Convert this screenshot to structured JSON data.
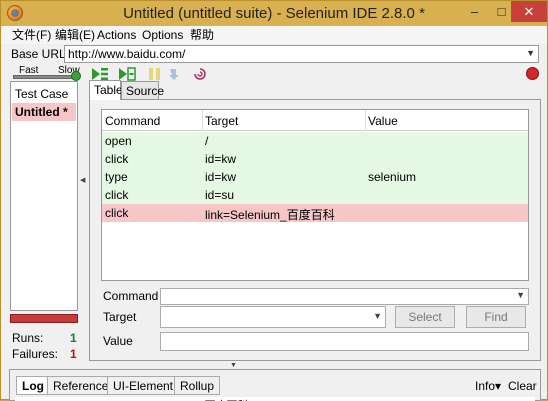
{
  "window": {
    "title": "Untitled (untitled suite) - Selenium IDE 2.8.0 *",
    "minimize": "–",
    "maximize": "□",
    "close": "✕"
  },
  "menu": {
    "items": [
      "文件(F)",
      "编辑(E)",
      "Actions",
      "Options",
      "帮助"
    ]
  },
  "base_url": {
    "label": "Base URL",
    "value": "http://www.baidu.com/"
  },
  "speed": {
    "fast_label": "Fast",
    "slow_label": "Slow",
    "position": 1.0
  },
  "toolbar": {
    "icons": [
      "play-suite-icon",
      "play-test-icon",
      "pause-icon",
      "step-icon",
      "rollup-icon",
      "record-icon"
    ]
  },
  "test_case_panel": {
    "header": "Test Case",
    "items": [
      {
        "name": "Untitled *",
        "status": "failed"
      }
    ]
  },
  "stats": {
    "runs_label": "Runs:",
    "runs_value": "1",
    "failures_label": "Failures:",
    "failures_value": "1",
    "progress_color": "#c93a3a"
  },
  "tabs": [
    "Table",
    "Source"
  ],
  "table": {
    "headers": [
      "Command",
      "Target",
      "Value"
    ],
    "rows": [
      {
        "command": "open",
        "target": "/",
        "value": "",
        "status": "pass"
      },
      {
        "command": "click",
        "target": "id=kw",
        "value": "",
        "status": "pass"
      },
      {
        "command": "type",
        "target": "id=kw",
        "value": "selenium",
        "status": "pass"
      },
      {
        "command": "click",
        "target": "id=su",
        "value": "",
        "status": "pass"
      },
      {
        "command": "click",
        "target": "link=Selenium_百度百科",
        "value": "",
        "status": "fail"
      }
    ],
    "colors": {
      "pass": "#e4f8e4",
      "fail": "#f7c6c6"
    }
  },
  "form": {
    "command_label": "Command",
    "target_label": "Target",
    "value_label": "Value",
    "select_button": "Select",
    "find_button": "Find"
  },
  "log_panel": {
    "tabs": [
      "Log",
      "Reference",
      "UI-Element",
      "Rollup"
    ],
    "info_label": "Info▾",
    "clear_label": "Clear",
    "first_line": "[info] Executing: |click | link=Selenium_百度百科 | |"
  }
}
